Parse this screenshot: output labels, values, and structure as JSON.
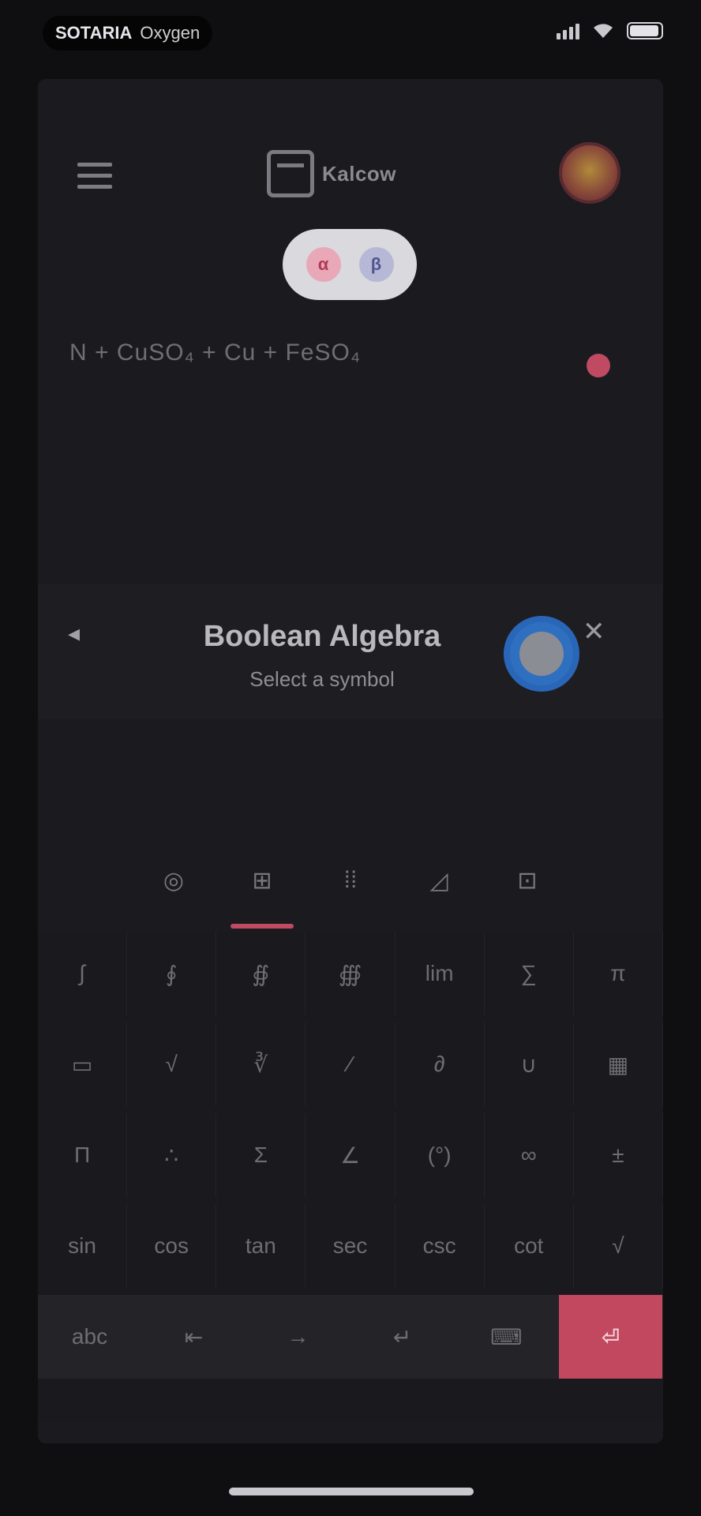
{
  "status_bar": {
    "carrier_bold": "SOTARIA",
    "carrier_rest": "Oxygen",
    "signal": "signal-icon",
    "wifi": "wifi-icon",
    "battery": "battery-icon"
  },
  "header": {
    "logo_text": "Kalcow",
    "menu_icon": "menu-icon",
    "avatar_icon": "avatar"
  },
  "toggle": {
    "left_label": "α",
    "right_label": "β"
  },
  "expression": {
    "text": "N + CuSO₄ + Cu + FeSO₄"
  },
  "panel": {
    "title": "Boolean Algebra",
    "subtitle": "Select a symbol",
    "back_label": "◂",
    "close_label": "✕"
  },
  "tabs": [
    {
      "label": "◎"
    },
    {
      "label": "⊞"
    },
    {
      "label": "⁞⁞"
    },
    {
      "label": "◿"
    },
    {
      "label": "⊡"
    }
  ],
  "keys": [
    [
      "∫",
      "∮",
      "∯",
      "∰",
      "lim",
      "∑",
      "π"
    ],
    [
      "▭",
      "√",
      "∛",
      "⁄",
      "∂",
      "∪",
      "▦"
    ],
    [
      "Π",
      "∴",
      "Σ",
      "∠",
      "(°)",
      "∞",
      "±"
    ],
    [
      "sin",
      "cos",
      "tan",
      "sec",
      "csc",
      "cot",
      "√"
    ],
    [
      "abc",
      "⇤",
      "→",
      "↵",
      "⌨",
      "⏎"
    ]
  ],
  "colors": {
    "accent": "#c24860",
    "background": "#1b1b1f",
    "fab": "#2f6fc0"
  }
}
